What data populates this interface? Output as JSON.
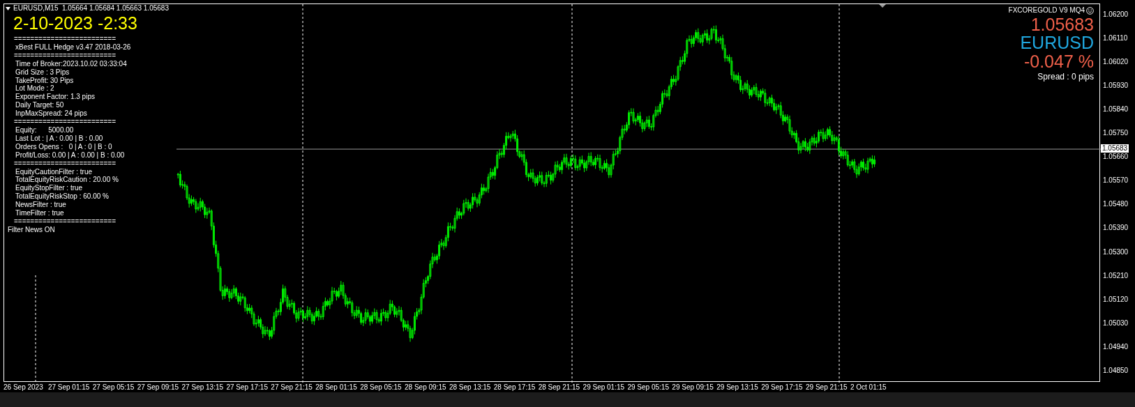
{
  "header": {
    "symbol_line": "EURUSD,M15  1.05664 1.05684 1.05663 1.05683"
  },
  "clock": "2-10-2023 -2:33",
  "info_panel": {
    "lines": [
      {
        "kind": "separator",
        "text": "========================="
      },
      {
        "kind": "line",
        "text": "xBest FULL Hedge v3.47 2018-03-26"
      },
      {
        "kind": "separator",
        "text": "========================="
      },
      {
        "kind": "line",
        "text": "Time of Broker:2023.10.02 03:33:04"
      },
      {
        "kind": "line",
        "text": "Grid Size : 3 Pips"
      },
      {
        "kind": "line",
        "text": "TakeProfit: 30 Pips"
      },
      {
        "kind": "line",
        "text": "Lot Mode : 2"
      },
      {
        "kind": "line",
        "text": "Exponent Factor: 1.3 pips"
      },
      {
        "kind": "line",
        "text": "Daily Target: 50"
      },
      {
        "kind": "line",
        "text": "InpMaxSpread: 24 pips"
      },
      {
        "kind": "separator",
        "text": "========================="
      },
      {
        "kind": "line",
        "text": "Equity:      5000.00"
      },
      {
        "kind": "line",
        "text": "Last Lot : | A : 0.00 | B : 0.00"
      },
      {
        "kind": "line",
        "text": "Orders Opens :   0 | A : 0 | B : 0"
      },
      {
        "kind": "line",
        "text": "Profit/Loss: 0.00 | A : 0.00 | B : 0.00"
      },
      {
        "kind": "separator",
        "text": "========================="
      },
      {
        "kind": "line",
        "text": "EquityCautionFilter : true"
      },
      {
        "kind": "line",
        "text": "TotalEquityRiskCaution : 20.00 %"
      },
      {
        "kind": "line",
        "text": "EquityStopFilter : true"
      },
      {
        "kind": "line",
        "text": "TotalEquityRiskStop : 60.00 %"
      },
      {
        "kind": "line",
        "text": "NewsFilter : true"
      },
      {
        "kind": "line",
        "text": "TimeFilter : true"
      },
      {
        "kind": "separator",
        "text": "========================="
      },
      {
        "kind": "status",
        "text": "Filter News ON"
      }
    ]
  },
  "ticker": {
    "brand": "FXCOREGOLD V9 MQ4",
    "price": "1.05683",
    "symbol": "EURUSD",
    "change": "-0.047 %",
    "spread": "Spread : 0 pips"
  },
  "price_axis": {
    "labels": [
      "1.06200",
      "1.06110",
      "1.06020",
      "1.05930",
      "1.05840",
      "1.05750",
      "1.05660",
      "1.05570",
      "1.05480",
      "1.05390",
      "1.05300",
      "1.05210",
      "1.05120",
      "1.05030",
      "1.04940",
      "1.04850"
    ],
    "current_price": "1.05683"
  },
  "time_axis": {
    "labels": [
      "26 Sep 2023",
      "27 Sep 01:15",
      "27 Sep 05:15",
      "27 Sep 09:15",
      "27 Sep 13:15",
      "27 Sep 17:15",
      "27 Sep 21:15",
      "28 Sep 01:15",
      "28 Sep 05:15",
      "28 Sep 09:15",
      "28 Sep 13:15",
      "28 Sep 17:15",
      "28 Sep 21:15",
      "29 Sep 01:15",
      "29 Sep 05:15",
      "29 Sep 09:15",
      "29 Sep 13:15",
      "29 Sep 17:15",
      "29 Sep 21:15",
      "2 Oct 01:15"
    ]
  }
}
